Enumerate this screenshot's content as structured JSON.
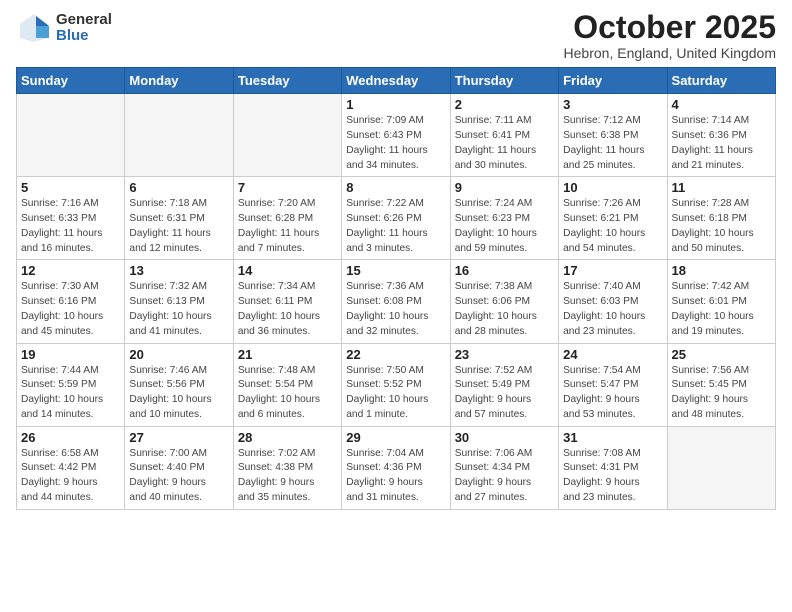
{
  "header": {
    "logo_general": "General",
    "logo_blue": "Blue",
    "month_title": "October 2025",
    "location": "Hebron, England, United Kingdom"
  },
  "weekdays": [
    "Sunday",
    "Monday",
    "Tuesday",
    "Wednesday",
    "Thursday",
    "Friday",
    "Saturday"
  ],
  "weeks": [
    [
      {
        "day": "",
        "info": ""
      },
      {
        "day": "",
        "info": ""
      },
      {
        "day": "",
        "info": ""
      },
      {
        "day": "1",
        "info": "Sunrise: 7:09 AM\nSunset: 6:43 PM\nDaylight: 11 hours\nand 34 minutes."
      },
      {
        "day": "2",
        "info": "Sunrise: 7:11 AM\nSunset: 6:41 PM\nDaylight: 11 hours\nand 30 minutes."
      },
      {
        "day": "3",
        "info": "Sunrise: 7:12 AM\nSunset: 6:38 PM\nDaylight: 11 hours\nand 25 minutes."
      },
      {
        "day": "4",
        "info": "Sunrise: 7:14 AM\nSunset: 6:36 PM\nDaylight: 11 hours\nand 21 minutes."
      }
    ],
    [
      {
        "day": "5",
        "info": "Sunrise: 7:16 AM\nSunset: 6:33 PM\nDaylight: 11 hours\nand 16 minutes."
      },
      {
        "day": "6",
        "info": "Sunrise: 7:18 AM\nSunset: 6:31 PM\nDaylight: 11 hours\nand 12 minutes."
      },
      {
        "day": "7",
        "info": "Sunrise: 7:20 AM\nSunset: 6:28 PM\nDaylight: 11 hours\nand 7 minutes."
      },
      {
        "day": "8",
        "info": "Sunrise: 7:22 AM\nSunset: 6:26 PM\nDaylight: 11 hours\nand 3 minutes."
      },
      {
        "day": "9",
        "info": "Sunrise: 7:24 AM\nSunset: 6:23 PM\nDaylight: 10 hours\nand 59 minutes."
      },
      {
        "day": "10",
        "info": "Sunrise: 7:26 AM\nSunset: 6:21 PM\nDaylight: 10 hours\nand 54 minutes."
      },
      {
        "day": "11",
        "info": "Sunrise: 7:28 AM\nSunset: 6:18 PM\nDaylight: 10 hours\nand 50 minutes."
      }
    ],
    [
      {
        "day": "12",
        "info": "Sunrise: 7:30 AM\nSunset: 6:16 PM\nDaylight: 10 hours\nand 45 minutes."
      },
      {
        "day": "13",
        "info": "Sunrise: 7:32 AM\nSunset: 6:13 PM\nDaylight: 10 hours\nand 41 minutes."
      },
      {
        "day": "14",
        "info": "Sunrise: 7:34 AM\nSunset: 6:11 PM\nDaylight: 10 hours\nand 36 minutes."
      },
      {
        "day": "15",
        "info": "Sunrise: 7:36 AM\nSunset: 6:08 PM\nDaylight: 10 hours\nand 32 minutes."
      },
      {
        "day": "16",
        "info": "Sunrise: 7:38 AM\nSunset: 6:06 PM\nDaylight: 10 hours\nand 28 minutes."
      },
      {
        "day": "17",
        "info": "Sunrise: 7:40 AM\nSunset: 6:03 PM\nDaylight: 10 hours\nand 23 minutes."
      },
      {
        "day": "18",
        "info": "Sunrise: 7:42 AM\nSunset: 6:01 PM\nDaylight: 10 hours\nand 19 minutes."
      }
    ],
    [
      {
        "day": "19",
        "info": "Sunrise: 7:44 AM\nSunset: 5:59 PM\nDaylight: 10 hours\nand 14 minutes."
      },
      {
        "day": "20",
        "info": "Sunrise: 7:46 AM\nSunset: 5:56 PM\nDaylight: 10 hours\nand 10 minutes."
      },
      {
        "day": "21",
        "info": "Sunrise: 7:48 AM\nSunset: 5:54 PM\nDaylight: 10 hours\nand 6 minutes."
      },
      {
        "day": "22",
        "info": "Sunrise: 7:50 AM\nSunset: 5:52 PM\nDaylight: 10 hours\nand 1 minute."
      },
      {
        "day": "23",
        "info": "Sunrise: 7:52 AM\nSunset: 5:49 PM\nDaylight: 9 hours\nand 57 minutes."
      },
      {
        "day": "24",
        "info": "Sunrise: 7:54 AM\nSunset: 5:47 PM\nDaylight: 9 hours\nand 53 minutes."
      },
      {
        "day": "25",
        "info": "Sunrise: 7:56 AM\nSunset: 5:45 PM\nDaylight: 9 hours\nand 48 minutes."
      }
    ],
    [
      {
        "day": "26",
        "info": "Sunrise: 6:58 AM\nSunset: 4:42 PM\nDaylight: 9 hours\nand 44 minutes."
      },
      {
        "day": "27",
        "info": "Sunrise: 7:00 AM\nSunset: 4:40 PM\nDaylight: 9 hours\nand 40 minutes."
      },
      {
        "day": "28",
        "info": "Sunrise: 7:02 AM\nSunset: 4:38 PM\nDaylight: 9 hours\nand 35 minutes."
      },
      {
        "day": "29",
        "info": "Sunrise: 7:04 AM\nSunset: 4:36 PM\nDaylight: 9 hours\nand 31 minutes."
      },
      {
        "day": "30",
        "info": "Sunrise: 7:06 AM\nSunset: 4:34 PM\nDaylight: 9 hours\nand 27 minutes."
      },
      {
        "day": "31",
        "info": "Sunrise: 7:08 AM\nSunset: 4:31 PM\nDaylight: 9 hours\nand 23 minutes."
      },
      {
        "day": "",
        "info": ""
      }
    ]
  ]
}
